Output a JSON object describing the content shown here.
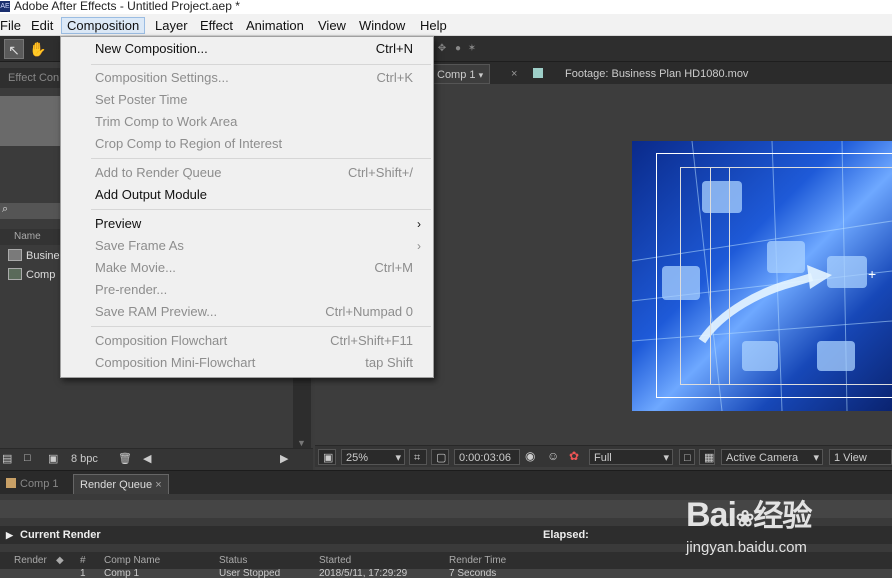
{
  "window": {
    "title": "Adobe After Effects - Untitled Project.aep *",
    "app_icon": "AE"
  },
  "menubar": {
    "items": [
      "File",
      "Edit",
      "Composition",
      "Layer",
      "Effect",
      "Animation",
      "View",
      "Window",
      "Help"
    ],
    "active": "Composition"
  },
  "composition_menu": {
    "items": [
      {
        "label": "New Composition...",
        "shortcut": "Ctrl+N",
        "enabled": true
      },
      {
        "label": "Composition Settings...",
        "shortcut": "Ctrl+K",
        "enabled": false
      },
      {
        "label": "Set Poster Time",
        "shortcut": "",
        "enabled": false
      },
      {
        "label": "Trim Comp to Work Area",
        "shortcut": "",
        "enabled": false
      },
      {
        "label": "Crop Comp to Region of Interest",
        "shortcut": "",
        "enabled": false
      },
      {
        "label": "Add to Render Queue",
        "shortcut": "Ctrl+Shift+/",
        "enabled": false
      },
      {
        "label": "Add Output Module",
        "shortcut": "",
        "enabled": true
      },
      {
        "label": "Preview",
        "shortcut": "",
        "enabled": true,
        "submenu": true
      },
      {
        "label": "Save Frame As",
        "shortcut": "",
        "enabled": false,
        "submenu": true
      },
      {
        "label": "Make Movie...",
        "shortcut": "Ctrl+M",
        "enabled": false
      },
      {
        "label": "Pre-render...",
        "shortcut": "",
        "enabled": false
      },
      {
        "label": "Save RAM Preview...",
        "shortcut": "Ctrl+Numpad 0",
        "enabled": false
      },
      {
        "label": "Composition Flowchart",
        "shortcut": "Ctrl+Shift+F11",
        "enabled": false
      },
      {
        "label": "Composition Mini-Flowchart",
        "shortcut": "tap Shift",
        "enabled": false
      }
    ]
  },
  "left_panel": {
    "tab": "Effect Con",
    "list_header": "Name",
    "items": [
      "Busine",
      "Comp"
    ],
    "bpc": "8 bpc"
  },
  "viewer": {
    "tabs": [
      "Comp 1",
      "Footage: Business Plan HD1080.mov"
    ],
    "zoom": "25%",
    "timecode": "0:00:03:06",
    "resolution": "Full",
    "camera": "Active Camera",
    "views": "1 View"
  },
  "bottom": {
    "tabs": [
      "Comp 1",
      "Render Queue"
    ],
    "current_render": "Current Render",
    "elapsed": "Elapsed:",
    "columns": [
      "Render",
      "#",
      "Comp Name",
      "Status",
      "Started",
      "Render Time"
    ],
    "row": {
      "num": "1",
      "comp": "Comp 1",
      "status": "User Stopped",
      "started": "2018/5/11, 17:29:29",
      "render_time": "7 Seconds"
    }
  },
  "watermark": {
    "brand": "Bai",
    "brand2": "经验",
    "url": "jingyan.baidu.com"
  },
  "colors": {
    "menu_highlight": "#dce9f7",
    "panel_bg": "#3c3c3c",
    "footage_blue": "#1e5ad8"
  }
}
